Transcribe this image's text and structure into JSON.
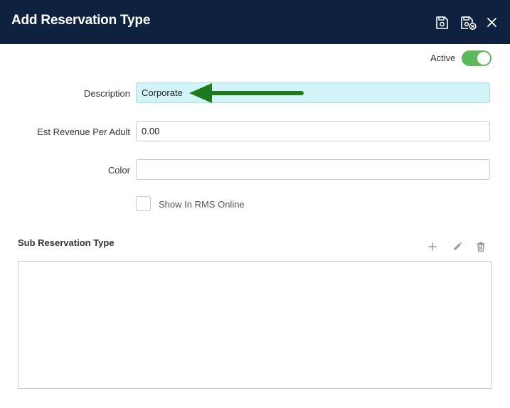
{
  "header": {
    "title": "Add Reservation Type",
    "icons": [
      "save-icon",
      "save-and-close-icon",
      "close-icon"
    ],
    "background": "#0e213f"
  },
  "active": {
    "label": "Active",
    "on": true,
    "color": "#5cb85c"
  },
  "form": {
    "description": {
      "label": "Description",
      "value": "Corporate",
      "highlight_color": "#d2f4f8"
    },
    "est_revenue": {
      "label": "Est Revenue Per Adult",
      "value": "0.00"
    },
    "color": {
      "label": "Color",
      "value": ""
    },
    "show_online": {
      "label": "Show In RMS Online",
      "checked": false
    }
  },
  "sub_reservation": {
    "title": "Sub Reservation Type",
    "tools": [
      "add-icon",
      "edit-icon",
      "delete-icon"
    ],
    "rows": []
  },
  "annotation": {
    "arrow_color": "#1e7a1e"
  }
}
